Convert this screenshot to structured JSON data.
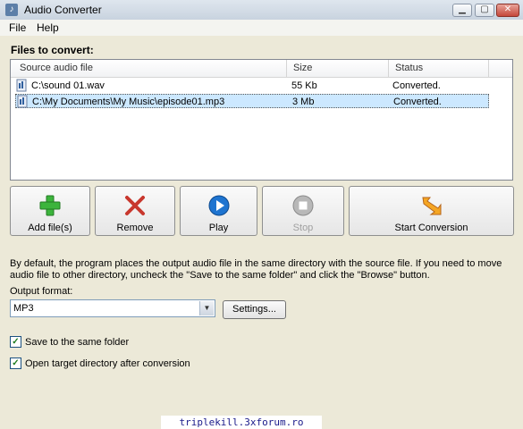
{
  "window": {
    "title": "Audio Converter"
  },
  "menu": {
    "file": "File",
    "help": "Help"
  },
  "files_label": "Files to convert:",
  "list": {
    "columns": [
      "Source audio file",
      "Size",
      "Status"
    ],
    "rows": [
      {
        "file": "C:\\sound 01.wav",
        "size": "55 Kb",
        "status": "Converted.",
        "icon": "audio-file-icon"
      },
      {
        "file": "C:\\My Documents\\My Music\\episode01.mp3",
        "size": "3 Mb",
        "status": "Converted.",
        "icon": "audio-file-icon",
        "selected": true
      }
    ]
  },
  "toolbar": {
    "add": "Add file(s)",
    "remove": "Remove",
    "play": "Play",
    "stop": "Stop",
    "start": "Start Conversion"
  },
  "description": "By default, the program places the output audio file in the same directory with the source file. If you need to move audio file to other directory, uncheck the \"Save to the same folder\" and click the \"Browse\" button.",
  "output": {
    "label": "Output format:",
    "value": "MP3",
    "settings": "Settings..."
  },
  "options": {
    "save_same": "Save to the same folder",
    "open_target": "Open target directory after conversion"
  },
  "watermark": "triplekill.3xforum.ro",
  "colors": {
    "accent": "#cce8ff",
    "add": "#3cb43c",
    "remove": "#c8372d",
    "play": "#1e74d0"
  }
}
